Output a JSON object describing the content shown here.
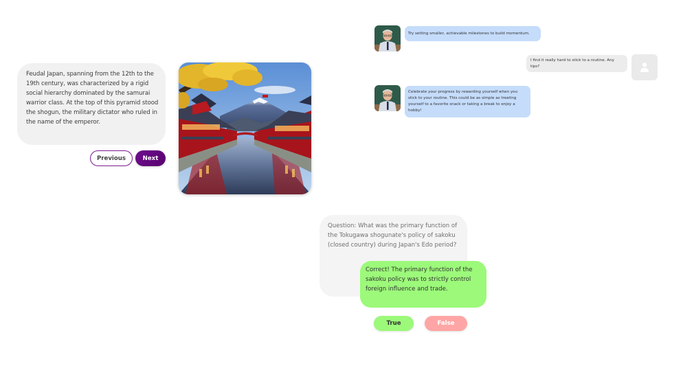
{
  "story": {
    "text": "Feudal Japan, spanning from the 12th to the 19th century, was characterized by a rigid social hierarchy dominated by the samurai warrior class. At the top of this pyramid stood the shogun, the military dictator who ruled in the name of the emperor.",
    "previous_label": "Previous",
    "next_label": "Next",
    "image_alt": "Japanese canal town with red buildings and Mount Fuji"
  },
  "chat": {
    "messages": [
      {
        "sender": "bot",
        "text": "Try setting smaller, achievable milestones to build momentum."
      },
      {
        "sender": "user",
        "text": "I find it really hard to stick to a routine. Any tips?"
      },
      {
        "sender": "bot",
        "text": "Celebrate your progress by rewarding yourself when you stick to your routine. This could be as simple as treating yourself to a favorite snack or taking a break to enjoy a hobby!"
      }
    ],
    "bot_avatar_alt": "Teacher avatar",
    "user_avatar_icon": "user-icon"
  },
  "quiz": {
    "question": "Question: What was the primary function of the Tokugawa shogunate's policy of sakoku (closed country) during Japan's Edo period?",
    "feedback": "Correct! The primary function of the sakoku policy was to strictly control foreign influence and trade.",
    "true_label": "True",
    "false_label": "False"
  },
  "colors": {
    "accent_purple": "#6e0f8e",
    "bot_bubble": "#c5dcfb",
    "user_bubble": "#ececec",
    "correct_green": "#9cf97a",
    "false_red": "#ffa5a5"
  }
}
